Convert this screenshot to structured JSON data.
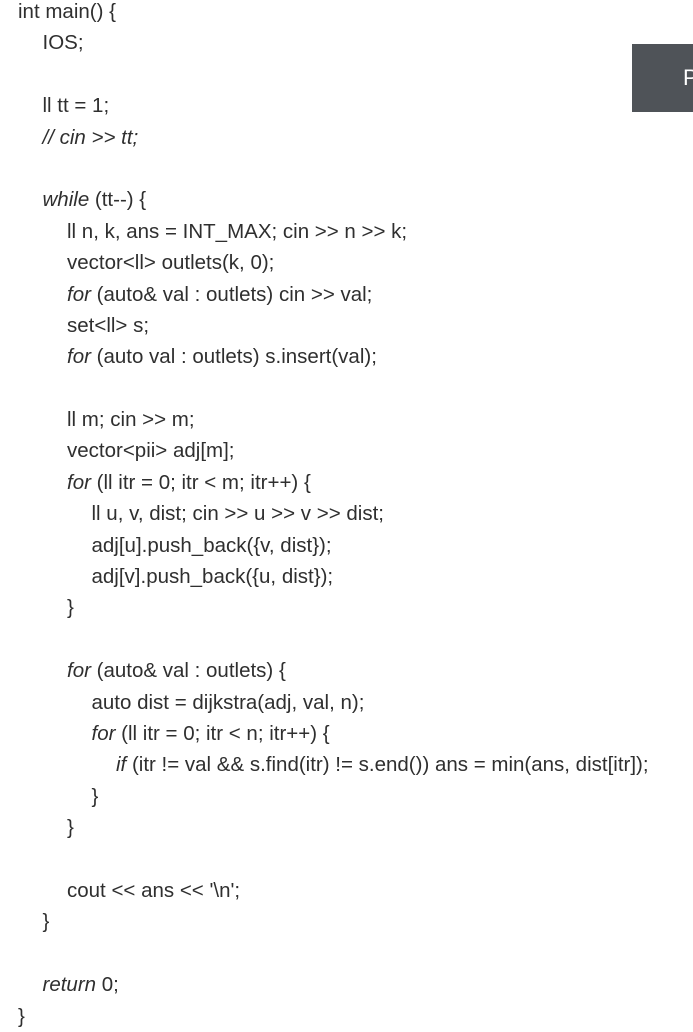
{
  "code": {
    "lines": [
      {
        "indent": 0,
        "parts": [
          {
            "t": "int main() {"
          }
        ]
      },
      {
        "indent": 1,
        "parts": [
          {
            "t": "IOS;"
          }
        ]
      },
      {
        "indent": 0,
        "parts": []
      },
      {
        "indent": 1,
        "parts": [
          {
            "t": "ll tt = 1;"
          }
        ]
      },
      {
        "indent": 1,
        "parts": [
          {
            "t": "// cin >> tt;",
            "s": "cmt"
          }
        ]
      },
      {
        "indent": 0,
        "parts": []
      },
      {
        "indent": 1,
        "parts": [
          {
            "t": "while",
            "s": "kw"
          },
          {
            "t": " (tt--) {"
          }
        ]
      },
      {
        "indent": 2,
        "parts": [
          {
            "t": "ll n, k, ans = INT_MAX; cin >> n >> k;"
          }
        ]
      },
      {
        "indent": 2,
        "parts": [
          {
            "t": "vector<ll> outlets(k, 0);"
          }
        ]
      },
      {
        "indent": 2,
        "parts": [
          {
            "t": "for",
            "s": "kw"
          },
          {
            "t": " (auto& val : outlets) cin >> val;"
          }
        ]
      },
      {
        "indent": 2,
        "parts": [
          {
            "t": "set<ll> s;"
          }
        ]
      },
      {
        "indent": 2,
        "parts": [
          {
            "t": "for",
            "s": "kw"
          },
          {
            "t": " (auto val : outlets) s.insert(val);"
          }
        ]
      },
      {
        "indent": 0,
        "parts": []
      },
      {
        "indent": 2,
        "parts": [
          {
            "t": "ll m; cin >> m;"
          }
        ]
      },
      {
        "indent": 2,
        "parts": [
          {
            "t": "vector<pii> adj[m];"
          }
        ]
      },
      {
        "indent": 2,
        "parts": [
          {
            "t": "for",
            "s": "kw"
          },
          {
            "t": " (ll itr = 0; itr < m; itr++) {"
          }
        ]
      },
      {
        "indent": 3,
        "parts": [
          {
            "t": "ll u, v, dist; cin >> u >> v >> dist;"
          }
        ]
      },
      {
        "indent": 3,
        "parts": [
          {
            "t": "adj[u].push_back({v, dist});"
          }
        ]
      },
      {
        "indent": 3,
        "parts": [
          {
            "t": "adj[v].push_back({u, dist});"
          }
        ]
      },
      {
        "indent": 2,
        "parts": [
          {
            "t": "}"
          }
        ]
      },
      {
        "indent": 0,
        "parts": []
      },
      {
        "indent": 2,
        "parts": [
          {
            "t": "for",
            "s": "kw"
          },
          {
            "t": " (auto& val : outlets) {"
          }
        ]
      },
      {
        "indent": 3,
        "parts": [
          {
            "t": "auto dist = dijkstra(adj, val, n);"
          }
        ]
      },
      {
        "indent": 3,
        "parts": [
          {
            "t": "for",
            "s": "kw"
          },
          {
            "t": " (ll itr = 0; itr < n; itr++) {"
          }
        ]
      },
      {
        "indent": 4,
        "parts": [
          {
            "t": "if",
            "s": "kw"
          },
          {
            "t": " (itr != val && s.find(itr) != s.end()) ans = min(ans, dist[itr]);"
          }
        ]
      },
      {
        "indent": 3,
        "parts": [
          {
            "t": "}"
          }
        ]
      },
      {
        "indent": 2,
        "parts": [
          {
            "t": "}"
          }
        ]
      },
      {
        "indent": 0,
        "parts": []
      },
      {
        "indent": 2,
        "parts": [
          {
            "t": "cout << ans << '\\n';"
          }
        ]
      },
      {
        "indent": 1,
        "parts": [
          {
            "t": "}"
          }
        ]
      },
      {
        "indent": 0,
        "parts": []
      },
      {
        "indent": 1,
        "parts": [
          {
            "t": "return",
            "s": "kw"
          },
          {
            "t": " 0;"
          }
        ]
      },
      {
        "indent": 0,
        "parts": [
          {
            "t": "}"
          }
        ]
      }
    ]
  },
  "side_button": {
    "label": "P",
    "color": "#4f5358"
  }
}
